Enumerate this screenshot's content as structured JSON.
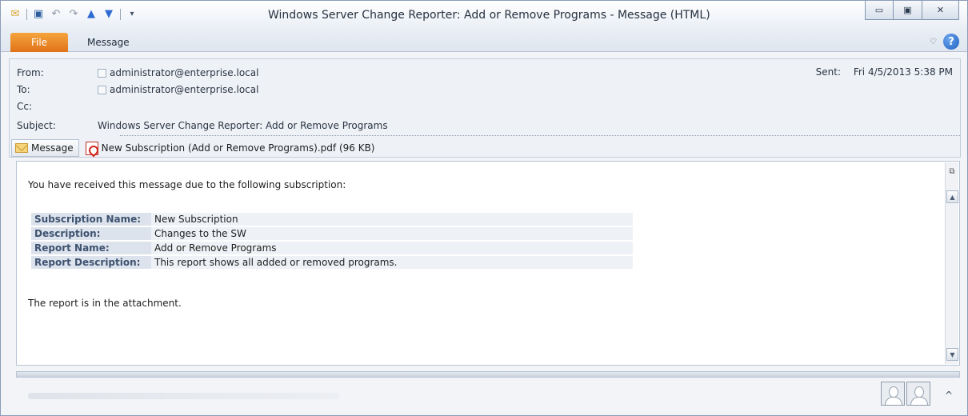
{
  "window": {
    "title": "Windows Server Change Reporter: Add or Remove Programs - Message (HTML)",
    "buttons": {
      "minimize": "▭",
      "maximize": "▣",
      "close": "✕"
    }
  },
  "qat": {
    "icons": [
      "envelope-icon",
      "save-icon",
      "undo-icon",
      "redo-icon",
      "up-arrow-icon",
      "down-arrow-icon",
      "customize-qat-icon"
    ]
  },
  "ribbon": {
    "file_tab": "File",
    "message_tab": "Message",
    "minimize_ribbon": "♡",
    "help": "?"
  },
  "header": {
    "from_label": "From:",
    "from_value": "administrator@enterprise.local",
    "to_label": "To:",
    "to_value": "administrator@enterprise.local",
    "cc_label": "Cc:",
    "cc_value": "",
    "subject_label": "Subject:",
    "subject_value": "Windows Server Change Reporter: Add or Remove Programs",
    "sent_label": "Sent:",
    "sent_value": "Fri 4/5/2013 5:38 PM"
  },
  "attachments": {
    "message_tab": "Message",
    "file": "New Subscription (Add or Remove Programs).pdf (96 KB)"
  },
  "body": {
    "intro": "You have received this message due to the following subscription:",
    "rows": [
      {
        "key": "Subscription Name:",
        "value": "New Subscription"
      },
      {
        "key": "Description:",
        "value": "Changes to the SW"
      },
      {
        "key": "Report Name:",
        "value": "Add or Remove Programs"
      },
      {
        "key": "Report Description:",
        "value": "This report shows all added or removed programs."
      }
    ],
    "outro": "The report is in the attachment."
  },
  "people_pane": {
    "expand": "^"
  }
}
